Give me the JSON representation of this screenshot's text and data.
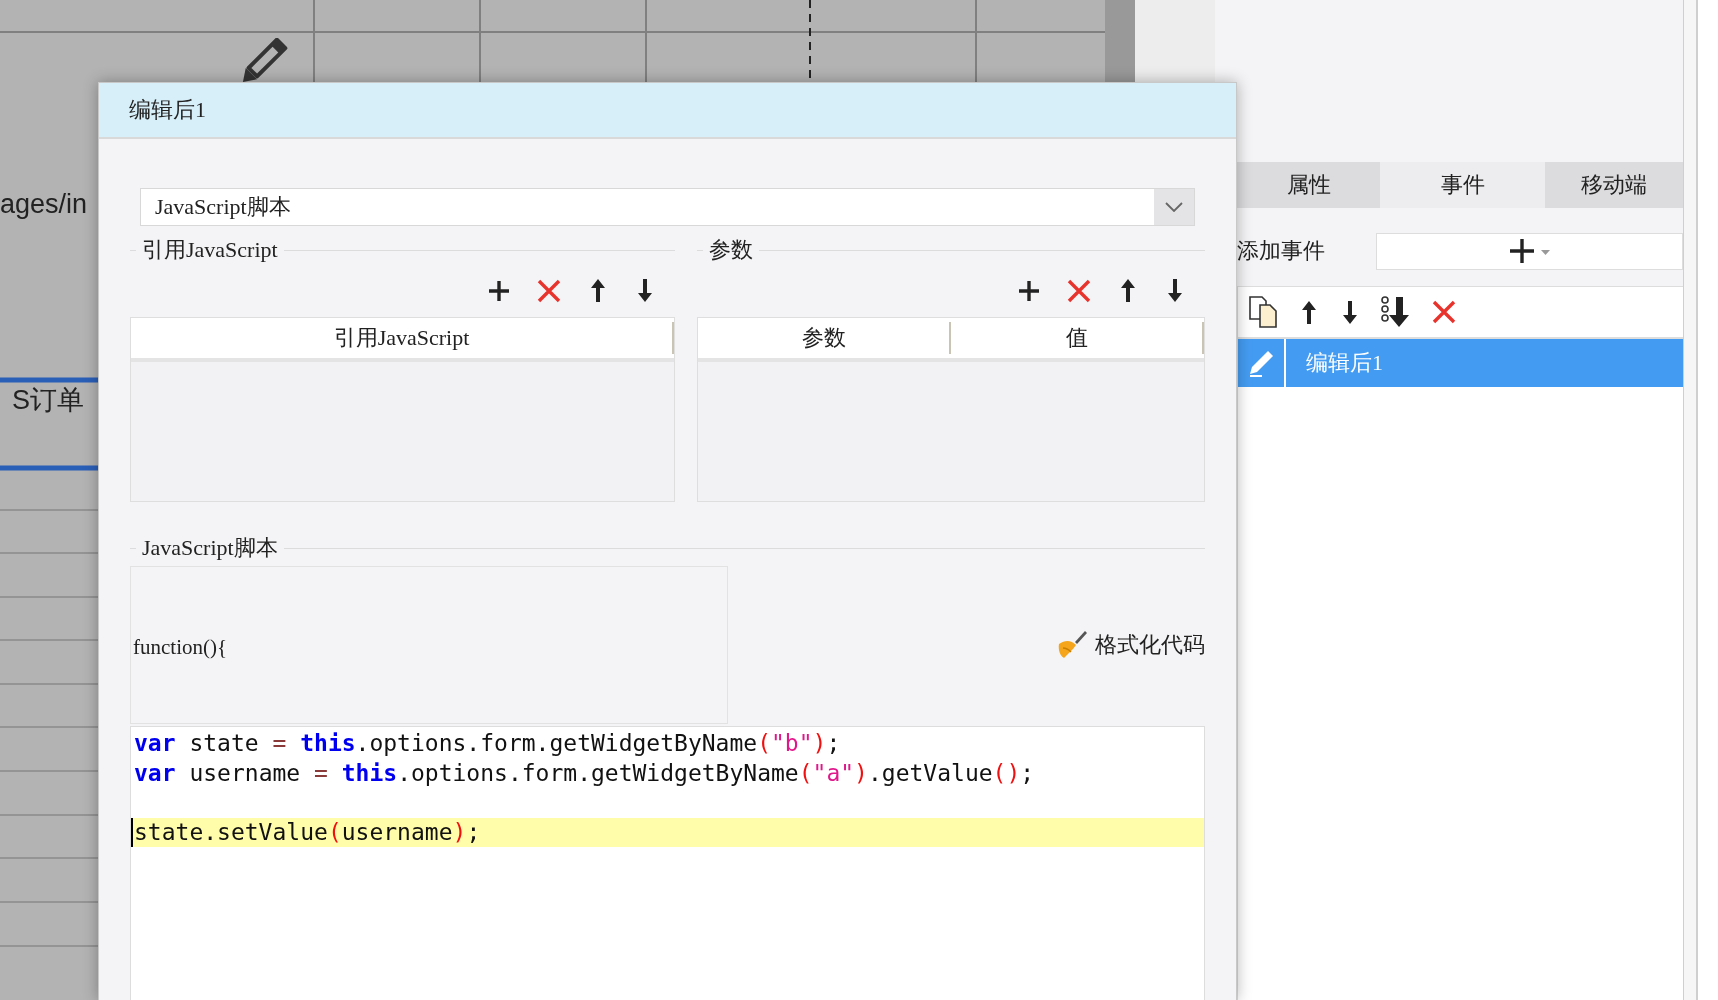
{
  "canvas": {
    "texts": [
      {
        "kind": "path",
        "text": "ages/in"
      },
      {
        "kind": "order",
        "text": "S订单"
      }
    ]
  },
  "dialog": {
    "title": "编辑后1",
    "script_type": {
      "value": "JavaScript脚本"
    },
    "references": {
      "legend": "引用JavaScript",
      "columns": [
        "引用JavaScript"
      ]
    },
    "parameters": {
      "legend": "参数",
      "columns": [
        "参数",
        "值"
      ]
    },
    "script": {
      "legend": "JavaScript脚本",
      "header": "function(){",
      "format_button": "格式化代码",
      "lines": [
        {
          "highlighted": false,
          "tokens": [
            {
              "kind": "keyword",
              "text": "var"
            },
            {
              "kind": "plain",
              "text": " state "
            },
            {
              "kind": "operator",
              "text": "= "
            },
            {
              "kind": "keyword",
              "text": "this"
            },
            {
              "kind": "plain",
              "text": ".options.form.getWidgetByName"
            },
            {
              "kind": "paren",
              "text": "("
            },
            {
              "kind": "string",
              "text": "\"b\""
            },
            {
              "kind": "paren",
              "text": ")"
            },
            {
              "kind": "plain",
              "text": ";"
            }
          ]
        },
        {
          "highlighted": false,
          "tokens": [
            {
              "kind": "keyword",
              "text": "var"
            },
            {
              "kind": "plain",
              "text": " username "
            },
            {
              "kind": "operator",
              "text": "= "
            },
            {
              "kind": "keyword",
              "text": "this"
            },
            {
              "kind": "plain",
              "text": ".options.form.getWidgetByName"
            },
            {
              "kind": "paren",
              "text": "("
            },
            {
              "kind": "string",
              "text": "\"a\""
            },
            {
              "kind": "paren",
              "text": ")"
            },
            {
              "kind": "plain",
              "text": ".getValue"
            },
            {
              "kind": "paren",
              "text": "()"
            },
            {
              "kind": "plain",
              "text": ";"
            }
          ]
        },
        {
          "highlighted": true,
          "blank_before": true,
          "tokens": [
            {
              "kind": "plain",
              "text": "state.setValue"
            },
            {
              "kind": "paren",
              "text": "("
            },
            {
              "kind": "plain",
              "text": "username"
            },
            {
              "kind": "paren",
              "text": ")"
            },
            {
              "kind": "plain",
              "text": ";"
            }
          ]
        }
      ]
    }
  },
  "panel": {
    "tabs": [
      {
        "label": "属性",
        "selected": false
      },
      {
        "label": "事件",
        "selected": true
      },
      {
        "label": "移动端",
        "selected": false
      }
    ],
    "add_event_label": "添加事件",
    "events": [
      {
        "label": "编辑后1",
        "selected": true
      }
    ]
  }
}
